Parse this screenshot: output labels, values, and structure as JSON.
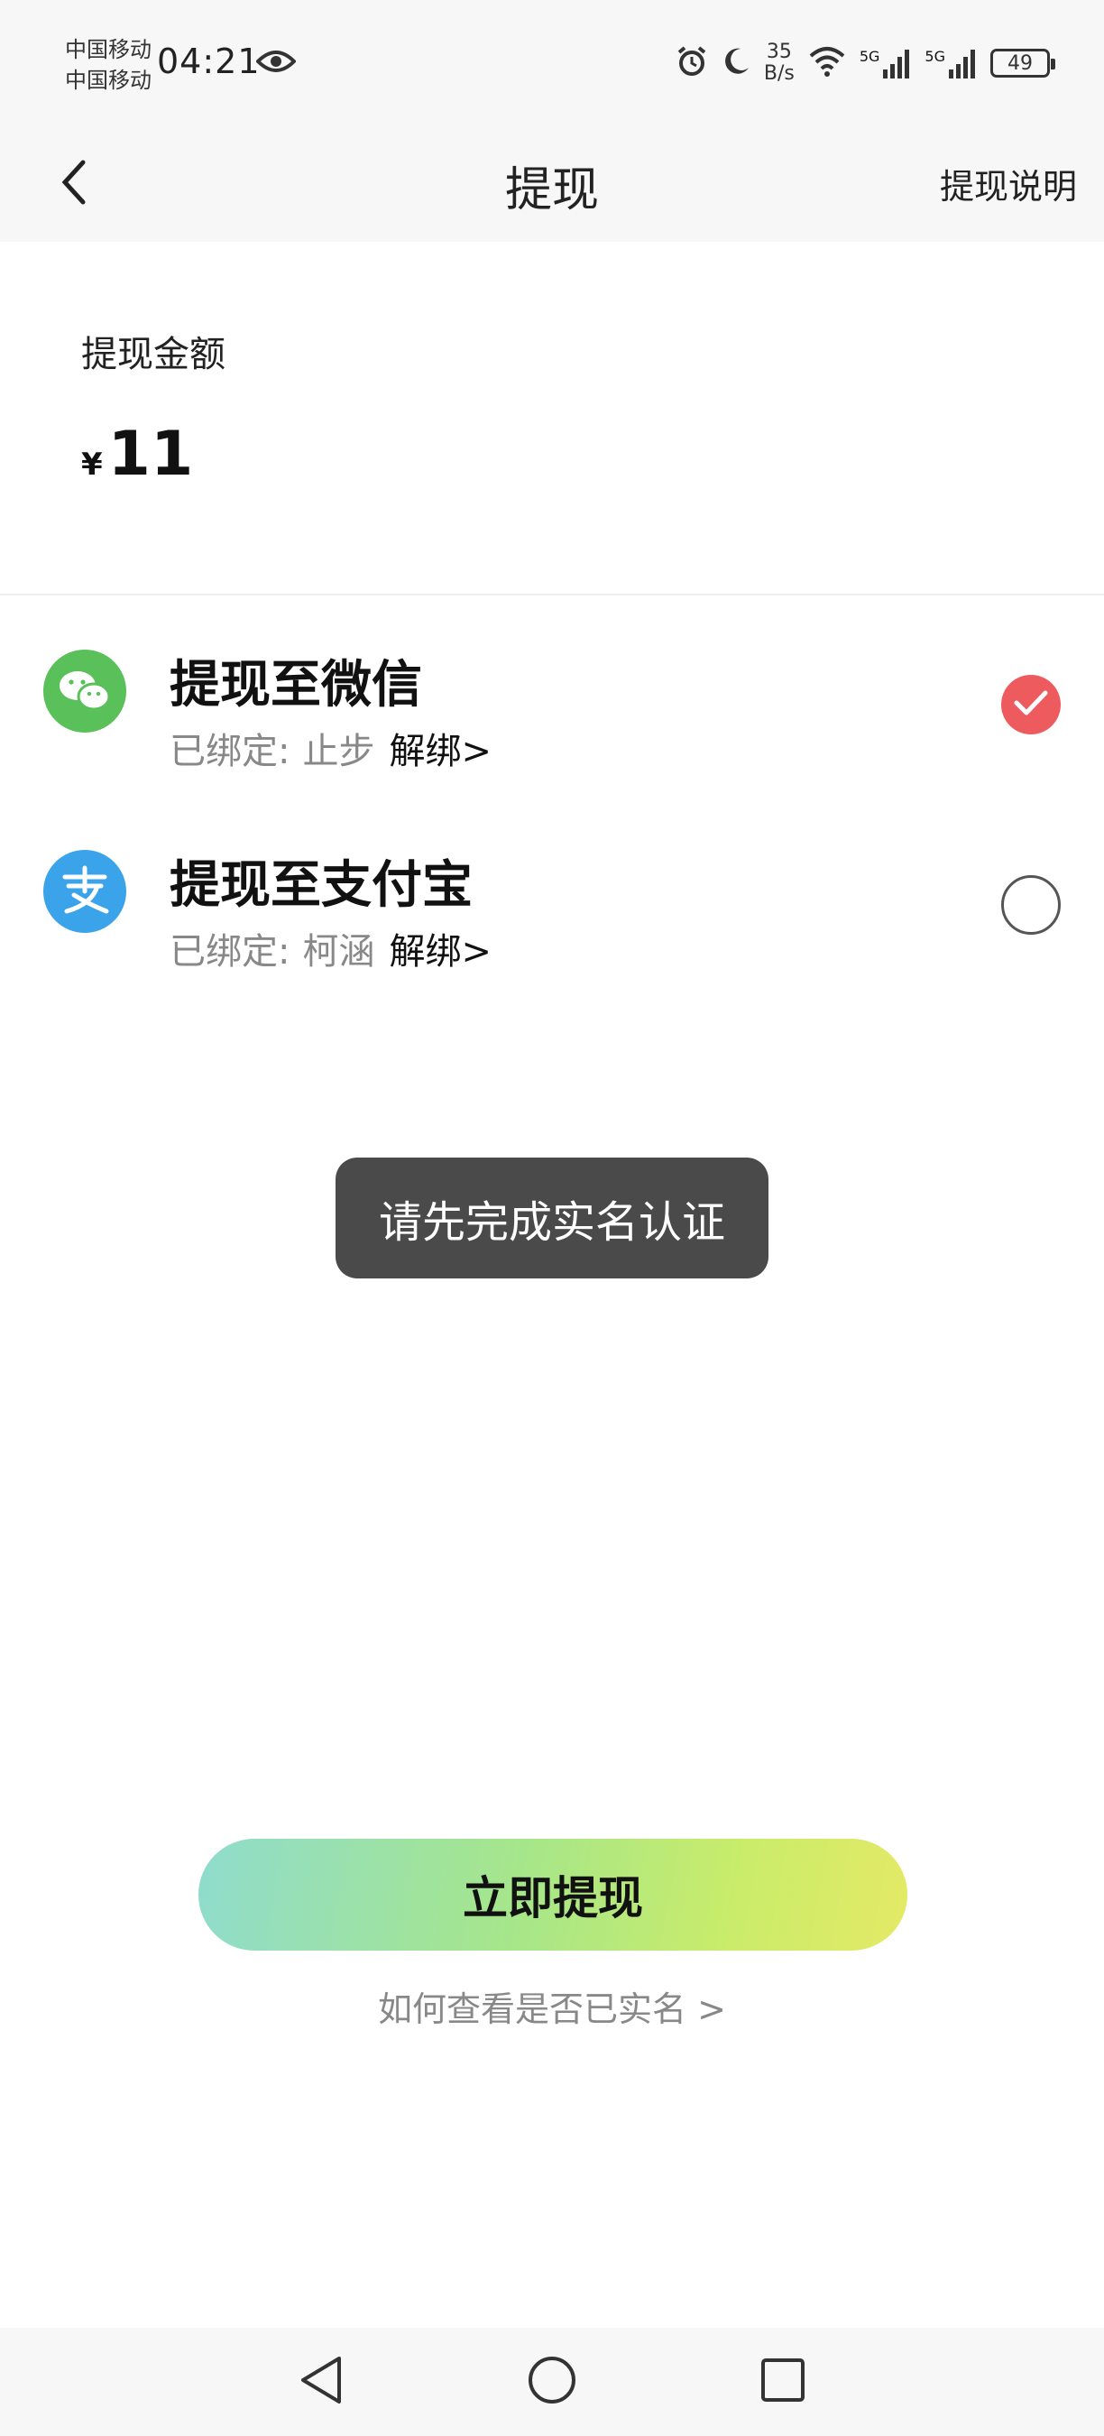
{
  "status_bar": {
    "carrier_1": "中国移动",
    "carrier_2": "中国移动",
    "time": "04:21",
    "net_speed_value": "35",
    "net_speed_unit": "B/s",
    "signal_1_label": "5G",
    "signal_2_label": "5G",
    "battery": "49",
    "icons": [
      "eye-icon",
      "alarm-icon",
      "moon-icon",
      "wifi-icon",
      "signal-icon",
      "battery-icon"
    ]
  },
  "nav": {
    "title": "提现",
    "right_link": "提现说明",
    "back_icon": "chevron-left-icon"
  },
  "amount": {
    "label": "提现金额",
    "currency": "¥",
    "value": "11"
  },
  "options": [
    {
      "title": "提现至微信",
      "bound_label": "已绑定:",
      "bound_name": "止步",
      "unbind": "解绑>",
      "selected": true,
      "icon": "wechat-icon",
      "color": "#5ac05a"
    },
    {
      "title": "提现至支付宝",
      "bound_label": "已绑定:",
      "bound_name": "柯涵",
      "unbind": "解绑>",
      "selected": false,
      "icon": "alipay-icon",
      "color": "#3aa3ea"
    }
  ],
  "toast": "请先完成实名认证",
  "withdraw_button": "立即提现",
  "help_link": "如何查看是否已实名 >",
  "colors": {
    "selected_radio": "#ee5b5f",
    "toast_bg": "#4a4a4a",
    "button_gradient_start": "#8fdccd",
    "button_gradient_end": "#e4ea66"
  }
}
